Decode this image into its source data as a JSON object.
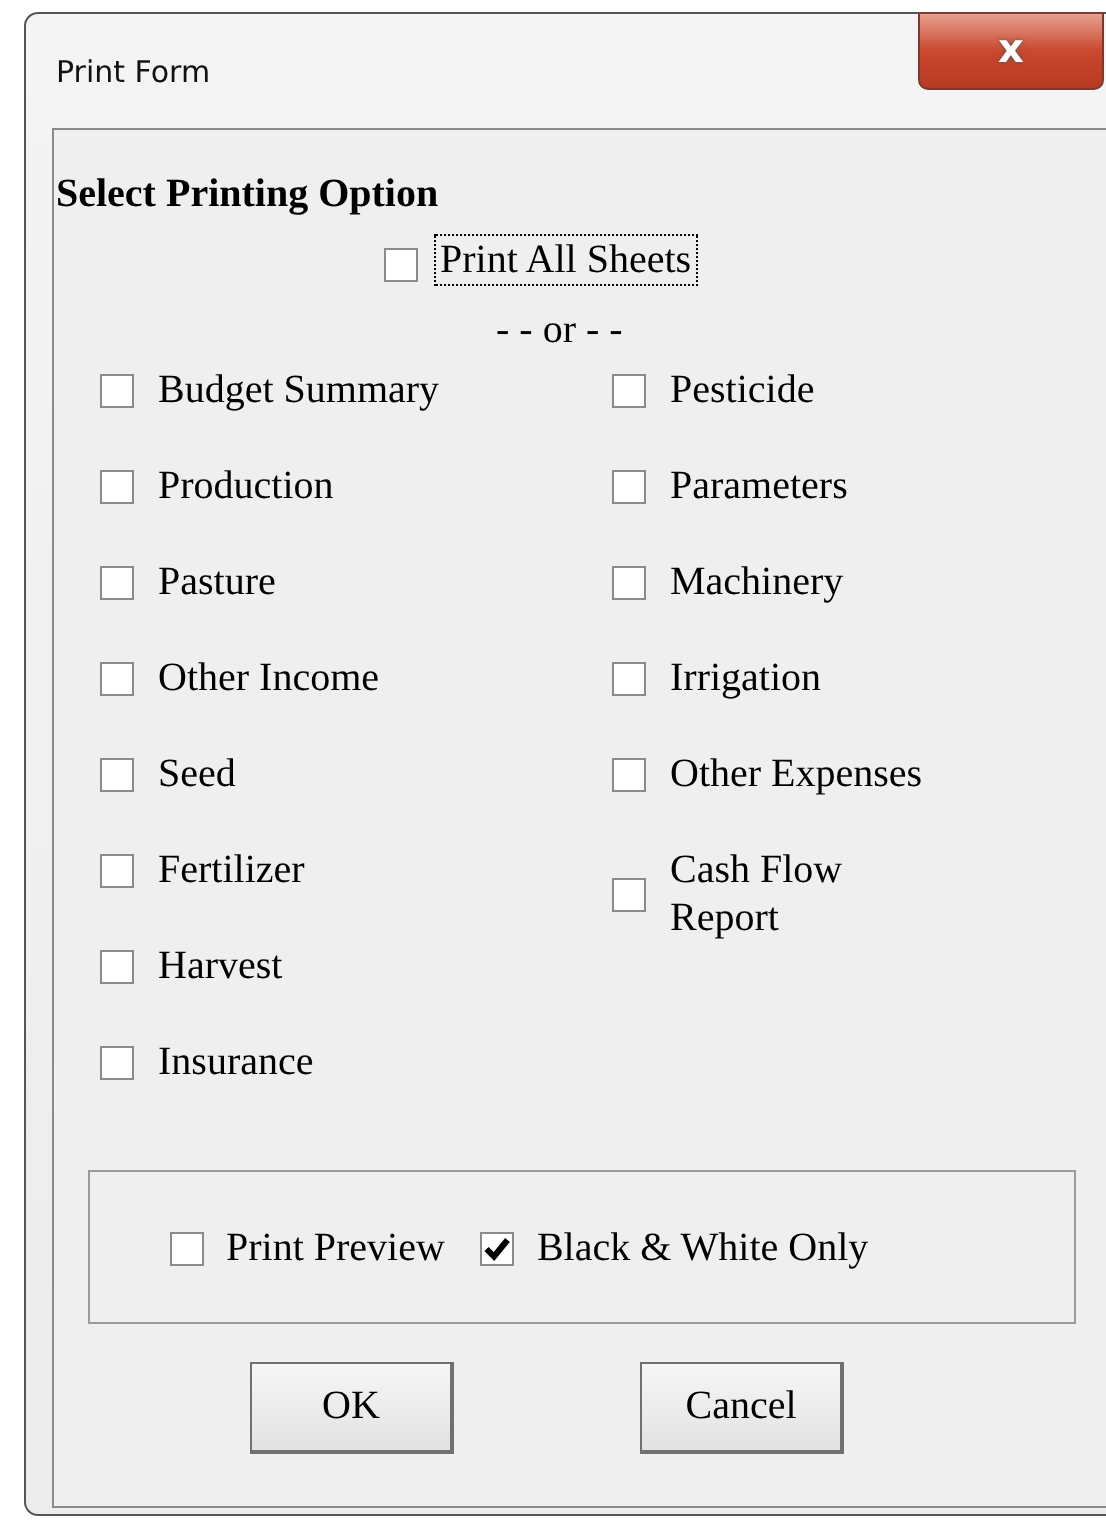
{
  "window": {
    "title": "Print Form",
    "close_glyph": "x"
  },
  "heading": "Select Printing Option",
  "print_all": {
    "label": "Print All Sheets",
    "checked": false,
    "focused": true
  },
  "separator": "- - or - -",
  "left_options": [
    {
      "label": "Budget Summary",
      "checked": false
    },
    {
      "label": "Production",
      "checked": false
    },
    {
      "label": "Pasture",
      "checked": false
    },
    {
      "label": "Other Income",
      "checked": false
    },
    {
      "label": "Seed",
      "checked": false
    },
    {
      "label": "Fertilizer",
      "checked": false
    },
    {
      "label": "Harvest",
      "checked": false
    },
    {
      "label": "Insurance",
      "checked": false
    }
  ],
  "right_options": [
    {
      "label": "Pesticide",
      "checked": false
    },
    {
      "label": "Parameters",
      "checked": false
    },
    {
      "label": "Machinery",
      "checked": false
    },
    {
      "label": "Irrigation",
      "checked": false
    },
    {
      "label": "Other Expenses",
      "checked": false
    },
    {
      "label": "Cash Flow Report",
      "checked": false
    }
  ],
  "settings": [
    {
      "label": "Print Preview",
      "checked": false
    },
    {
      "label": "Black & White Only",
      "checked": true
    }
  ],
  "buttons": [
    "OK",
    "Cancel"
  ]
}
